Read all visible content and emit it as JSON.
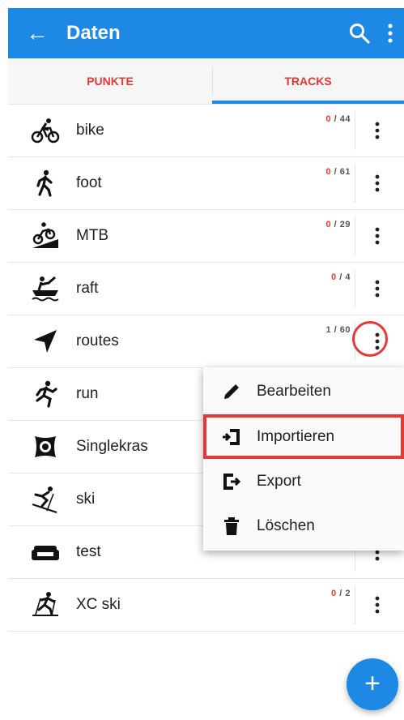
{
  "appbar": {
    "title": "Daten",
    "back_glyph": "←",
    "icons": [
      "arrow-back-icon",
      "search-icon",
      "more-vert-icon"
    ]
  },
  "tabs": [
    {
      "label": "PUNKTE",
      "selected": false
    },
    {
      "label": "TRACKS",
      "selected": true
    }
  ],
  "rows": [
    {
      "name": "bike",
      "count_zero": "0",
      "count_rest": " / 44",
      "icon": "bike-icon"
    },
    {
      "name": "foot",
      "count_zero": "0",
      "count_rest": " / 61",
      "icon": "walker-icon"
    },
    {
      "name": "MTB",
      "count_zero": "0",
      "count_rest": " / 29",
      "icon": "mtb-icon"
    },
    {
      "name": "raft",
      "count_zero": "0",
      "count_rest": " / 4",
      "icon": "raft-icon"
    },
    {
      "name": "routes",
      "count_zero": "",
      "count_rest": "1 / 60",
      "icon": "navigation-arrow-icon"
    },
    {
      "name": "run",
      "count_zero": "",
      "count_rest": "",
      "icon": "runner-icon"
    },
    {
      "name": "Singlekras",
      "count_zero": "",
      "count_rest": "",
      "icon": "singlekras-icon"
    },
    {
      "name": "ski",
      "count_zero": "",
      "count_rest": "",
      "icon": "skier-icon"
    },
    {
      "name": "test",
      "count_zero": "",
      "count_rest": "",
      "icon": "sofa-icon"
    },
    {
      "name": "XC ski",
      "count_zero": "0",
      "count_rest": " / 2",
      "icon": "xc-skier-icon"
    }
  ],
  "menu": {
    "items": [
      {
        "label": "Bearbeiten",
        "icon": "pencil-icon"
      },
      {
        "label": "Importieren",
        "icon": "import-icon",
        "highlighted": true
      },
      {
        "label": "Export",
        "icon": "export-icon"
      },
      {
        "label": "Löschen",
        "icon": "trash-icon"
      }
    ]
  },
  "fab": {
    "glyph": "+",
    "icon": "add-icon"
  },
  "colors": {
    "primary": "#1e88e5",
    "accent_red": "#e53935",
    "text": "#212121"
  }
}
